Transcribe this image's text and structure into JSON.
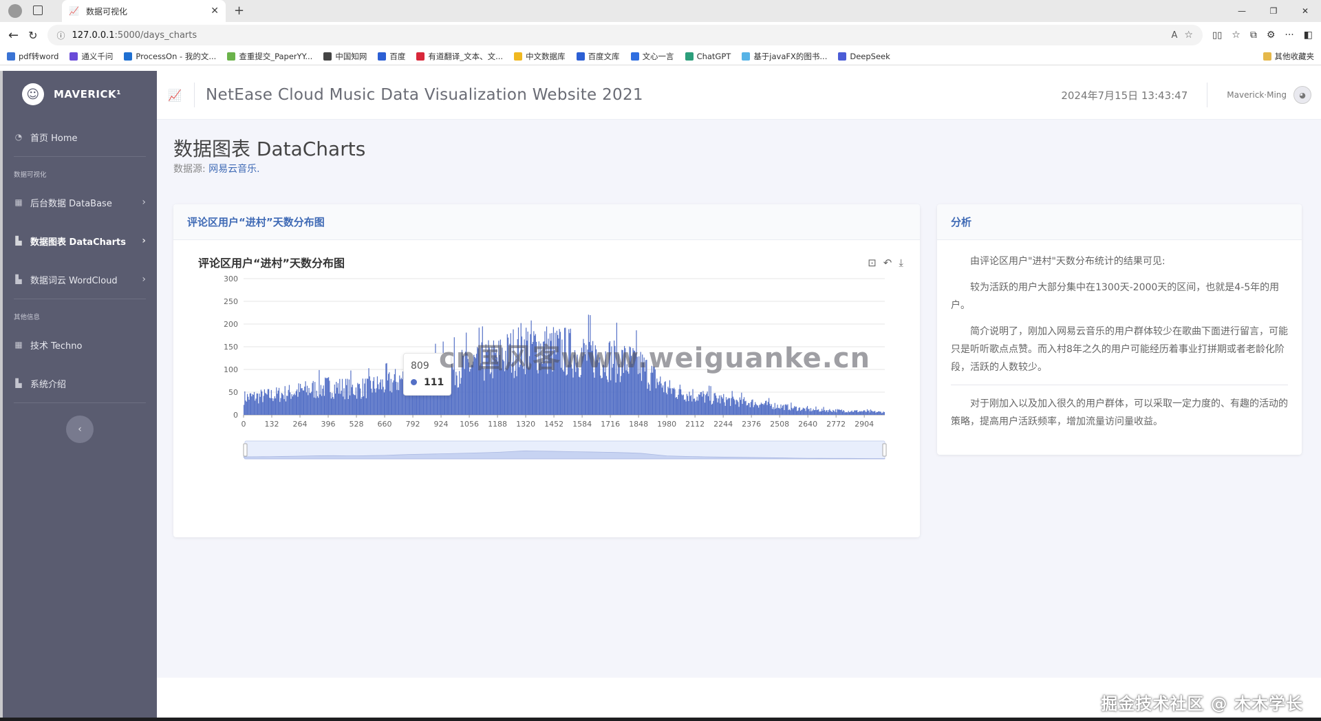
{
  "browser": {
    "tab_title": "数据可视化",
    "url_host": "127.0.0.1",
    "url_path": ":5000/days_charts",
    "bookmarks": [
      "pdf转word",
      "通义千问",
      "ProcessOn - 我的文...",
      "查重提交_PaperYY...",
      "中国知网",
      "百度",
      "有道翻译_文本、文...",
      "中文数据库",
      "百度文库",
      "文心一言",
      "ChatGPT",
      "基于javaFX的图书...",
      "DeepSeek"
    ],
    "bookmarks_folder": "其他收藏夹"
  },
  "sidebar": {
    "brand": "MAVERICK¹",
    "home": "首页 Home",
    "section1": "数据可视化",
    "items": [
      "后台数据 DataBase",
      "数据图表 DataCharts",
      "数据词云 WordCloud"
    ],
    "section2": "其他信息",
    "items2": [
      "技术 Techno",
      "系统介绍"
    ]
  },
  "topbar": {
    "title": "NetEase Cloud Music Data Visualization Website 2021",
    "datetime": "2024年7月15日 13:43:47",
    "user": "Maverick·Ming"
  },
  "page": {
    "title": "数据图表 DataCharts",
    "source_label": "数据源: ",
    "source_link": "网易云音乐."
  },
  "chart_card": {
    "header": "评论区用户“进村”天数分布图"
  },
  "chart_data": {
    "type": "bar",
    "title": "评论区用户“进村”天数分布图",
    "x_ticks": [
      0,
      132,
      264,
      396,
      528,
      660,
      792,
      924,
      1056,
      1188,
      1320,
      1452,
      1584,
      1716,
      1848,
      1980,
      2112,
      2244,
      2376,
      2508,
      2640,
      2772,
      2904
    ],
    "x_range": [
      0,
      3000
    ],
    "ylim": [
      0,
      300
    ],
    "y_ticks": [
      0,
      50,
      100,
      150,
      200,
      250,
      300
    ],
    "envelope": [
      {
        "x": 0,
        "y": 40
      },
      {
        "x": 132,
        "y": 45
      },
      {
        "x": 264,
        "y": 55
      },
      {
        "x": 396,
        "y": 65
      },
      {
        "x": 528,
        "y": 60
      },
      {
        "x": 660,
        "y": 70
      },
      {
        "x": 792,
        "y": 90
      },
      {
        "x": 924,
        "y": 100
      },
      {
        "x": 1056,
        "y": 115
      },
      {
        "x": 1188,
        "y": 130
      },
      {
        "x": 1320,
        "y": 160
      },
      {
        "x": 1452,
        "y": 150
      },
      {
        "x": 1584,
        "y": 140
      },
      {
        "x": 1716,
        "y": 130
      },
      {
        "x": 1848,
        "y": 115
      },
      {
        "x": 1980,
        "y": 60
      },
      {
        "x": 2112,
        "y": 45
      },
      {
        "x": 2244,
        "y": 35
      },
      {
        "x": 2376,
        "y": 28
      },
      {
        "x": 2508,
        "y": 20
      },
      {
        "x": 2640,
        "y": 12
      },
      {
        "x": 2772,
        "y": 10
      },
      {
        "x": 2904,
        "y": 8
      },
      {
        "x": 3000,
        "y": 6
      }
    ],
    "tooltip": {
      "x": "809",
      "value": "111"
    },
    "color": "#5470c6",
    "grid": true,
    "datazoom": true
  },
  "analysis": {
    "header": "分析",
    "p1": "由评论区用户\"进村\"天数分布统计的结果可见:",
    "p2": "较为活跃的用户大部分集中在1300天-2000天的区间，也就是4-5年的用户。",
    "p3": "简介说明了，刚加入网易云音乐的用户群体较少在歌曲下面进行留言，可能只是听听歌点点赞。而入村8年之久的用户可能经历着事业打拼期或者老龄化阶段，活跃的人数较少。",
    "p4": "对于刚加入以及加入很久的用户群体，可以采取一定力度的、有趣的活动的策略，提高用户活跃频率，增加流量访问量收益。"
  },
  "overlay": {
    "watermark": "cn国风客www.weiguanke.cn",
    "credit": "掘金技术社区 @ 木木学长"
  }
}
